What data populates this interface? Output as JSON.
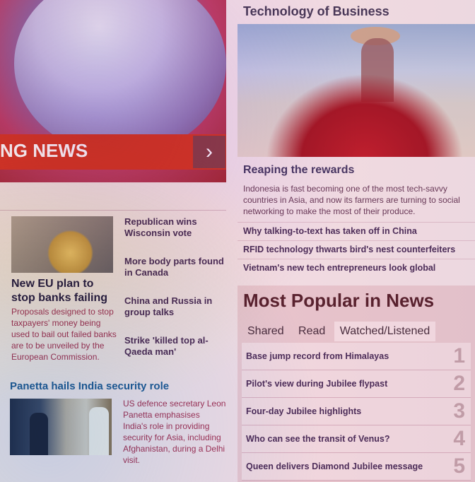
{
  "hero": {
    "banner_text": "NG NEWS",
    "arrow": "›"
  },
  "eu_story": {
    "title": "New EU plan to stop banks failing",
    "description": "Proposals designed to stop taxpayers' money being used to bail out failed banks are to be unveiled by the European Commission."
  },
  "side_headlines": [
    "Republican wins Wisconsin vote",
    "More body parts found in Canada",
    "China and Russia in group talks",
    "Strike 'killed top al-Qaeda man'"
  ],
  "panetta": {
    "title": "Panetta hails India security role",
    "description": "US defence secretary Leon Panetta emphasises India's role in providing security for Asia, including Afghanistan, during a Delhi visit."
  },
  "tech": {
    "section_title": "Technology of Business",
    "feature_title": "Reaping the rewards",
    "feature_desc": "Indonesia is fast becoming one of the most tech-savvy countries in Asia, and now its farmers are turning to social networking to make the most of their produce.",
    "links": [
      "Why talking-to-text has taken off in China",
      "RFID technology thwarts bird's nest counterfeiters",
      "Vietnam's new tech entrepreneurs look global"
    ]
  },
  "popular": {
    "title": "Most Popular in News",
    "tabs": [
      "Shared",
      "Read",
      "Watched/Listened"
    ],
    "active_tab": "Watched/Listened",
    "items": [
      {
        "label": "Base jump record from Himalayas",
        "rank": "1"
      },
      {
        "label": "Pilot's view during Jubilee flypast",
        "rank": "2"
      },
      {
        "label": "Four-day Jubilee highlights",
        "rank": "3"
      },
      {
        "label": "Who can see the transit of Venus?",
        "rank": "4"
      },
      {
        "label": "Queen delivers Diamond Jubilee message",
        "rank": "5"
      }
    ]
  }
}
